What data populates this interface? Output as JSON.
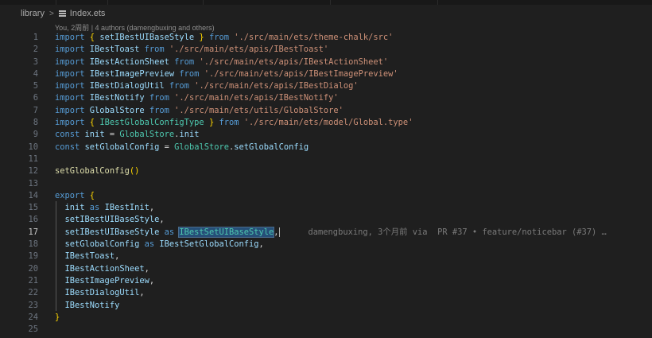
{
  "breadcrumb": {
    "folder": "library",
    "file": "Index.ets"
  },
  "codelens": "You, 2周前 | 4 authors (damengbuxing and others)",
  "lines": [
    {
      "n": "1",
      "tokens": [
        [
          "k",
          "import "
        ],
        [
          "y",
          "{ "
        ],
        [
          "i",
          "setIBestUIBaseStyle"
        ],
        [
          "y",
          " }"
        ],
        [
          "k",
          " from "
        ],
        [
          "s",
          "'./src/main/ets/theme-chalk/src'"
        ]
      ]
    },
    {
      "n": "2",
      "tokens": [
        [
          "k",
          "import "
        ],
        [
          "i",
          "IBestToast"
        ],
        [
          "k",
          " from "
        ],
        [
          "s",
          "'./src/main/ets/apis/IBestToast'"
        ]
      ]
    },
    {
      "n": "3",
      "tokens": [
        [
          "k",
          "import "
        ],
        [
          "i",
          "IBestActionSheet"
        ],
        [
          "k",
          " from "
        ],
        [
          "s",
          "'./src/main/ets/apis/IBestActionSheet'"
        ]
      ]
    },
    {
      "n": "4",
      "tokens": [
        [
          "k",
          "import "
        ],
        [
          "i",
          "IBestImagePreview"
        ],
        [
          "k",
          " from "
        ],
        [
          "s",
          "'./src/main/ets/apis/IBestImagePreview'"
        ]
      ]
    },
    {
      "n": "5",
      "tokens": [
        [
          "k",
          "import "
        ],
        [
          "i",
          "IBestDialogUtil"
        ],
        [
          "k",
          " from "
        ],
        [
          "s",
          "'./src/main/ets/apis/IBestDialog'"
        ]
      ]
    },
    {
      "n": "6",
      "tokens": [
        [
          "k",
          "import "
        ],
        [
          "i",
          "IBestNotify"
        ],
        [
          "k",
          " from "
        ],
        [
          "s",
          "'./src/main/ets/apis/IBestNotify'"
        ]
      ]
    },
    {
      "n": "7",
      "tokens": [
        [
          "k",
          "import "
        ],
        [
          "i",
          "GlobalStore"
        ],
        [
          "k",
          " from "
        ],
        [
          "s",
          "'./src/main/ets/utils/GlobalStore'"
        ]
      ]
    },
    {
      "n": "8",
      "tokens": [
        [
          "k",
          "import "
        ],
        [
          "y",
          "{ "
        ],
        [
          "c",
          "IBestGlobalConfigType"
        ],
        [
          "y",
          " }"
        ],
        [
          "k",
          " from "
        ],
        [
          "s",
          "'./src/main/ets/model/Global.type'"
        ]
      ]
    },
    {
      "n": "9",
      "tokens": [
        [
          "k",
          "const "
        ],
        [
          "i",
          "init"
        ],
        [
          "p",
          " = "
        ],
        [
          "c",
          "GlobalStore"
        ],
        [
          "p",
          "."
        ],
        [
          "i",
          "init"
        ]
      ]
    },
    {
      "n": "10",
      "tokens": [
        [
          "k",
          "const "
        ],
        [
          "i",
          "setGlobalConfig"
        ],
        [
          "p",
          " = "
        ],
        [
          "c",
          "GlobalStore"
        ],
        [
          "p",
          "."
        ],
        [
          "i",
          "setGlobalConfig"
        ]
      ]
    },
    {
      "n": "11",
      "tokens": []
    },
    {
      "n": "12",
      "tokens": [
        [
          "f",
          "setGlobalConfig"
        ],
        [
          "y",
          "()"
        ]
      ]
    },
    {
      "n": "13",
      "tokens": []
    },
    {
      "n": "14",
      "tokens": [
        [
          "k",
          "export "
        ],
        [
          "y",
          "{"
        ]
      ]
    },
    {
      "n": "15",
      "tokens": [
        [
          "p",
          "  "
        ],
        [
          "i",
          "init"
        ],
        [
          "k",
          " as "
        ],
        [
          "i",
          "IBestInit"
        ],
        [
          "p",
          ","
        ]
      ]
    },
    {
      "n": "16",
      "tokens": [
        [
          "p",
          "  "
        ],
        [
          "i",
          "setIBestUIBaseStyle"
        ],
        [
          "p",
          ","
        ]
      ]
    },
    {
      "n": "17",
      "active": true,
      "tokens": [
        [
          "p",
          "  "
        ],
        [
          "i",
          "setIBestUIBaseStyle"
        ],
        [
          "k",
          " as "
        ],
        [
          "hl",
          "IBestSetUIBaseStyle"
        ],
        [
          "p",
          ","
        ],
        [
          "cursor",
          ""
        ],
        [
          "blame",
          "damengbuxing, 3个月前 via  PR #37 • feature/noticebar (#37) …"
        ]
      ]
    },
    {
      "n": "18",
      "tokens": [
        [
          "p",
          "  "
        ],
        [
          "i",
          "setGlobalConfig"
        ],
        [
          "k",
          " as "
        ],
        [
          "i",
          "IBestSetGlobalConfig"
        ],
        [
          "p",
          ","
        ]
      ]
    },
    {
      "n": "19",
      "tokens": [
        [
          "p",
          "  "
        ],
        [
          "i",
          "IBestToast"
        ],
        [
          "p",
          ","
        ]
      ]
    },
    {
      "n": "20",
      "tokens": [
        [
          "p",
          "  "
        ],
        [
          "i",
          "IBestActionSheet"
        ],
        [
          "p",
          ","
        ]
      ]
    },
    {
      "n": "21",
      "tokens": [
        [
          "p",
          "  "
        ],
        [
          "i",
          "IBestImagePreview"
        ],
        [
          "p",
          ","
        ]
      ]
    },
    {
      "n": "22",
      "tokens": [
        [
          "p",
          "  "
        ],
        [
          "i",
          "IBestDialogUtil"
        ],
        [
          "p",
          ","
        ]
      ]
    },
    {
      "n": "23",
      "tokens": [
        [
          "p",
          "  "
        ],
        [
          "i",
          "IBestNotify"
        ]
      ]
    },
    {
      "n": "24",
      "tokens": [
        [
          "y",
          "}"
        ]
      ]
    },
    {
      "n": "25",
      "tokens": []
    }
  ]
}
